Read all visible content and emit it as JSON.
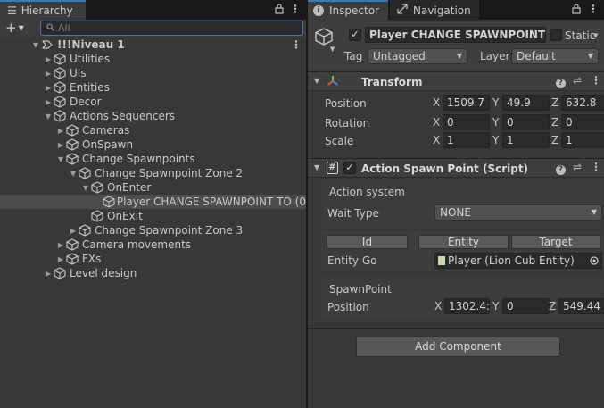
{
  "hierarchy": {
    "tab_label": "Hierarchy",
    "search_placeholder": "All",
    "tree": [
      {
        "label": "!!!Niveau 1",
        "indent": 0,
        "expanded": true,
        "scene": true
      },
      {
        "label": "Utilities",
        "indent": 1,
        "expanded": false
      },
      {
        "label": "UIs",
        "indent": 1,
        "expanded": false
      },
      {
        "label": "Entities",
        "indent": 1,
        "expanded": false
      },
      {
        "label": "Decor",
        "indent": 1,
        "expanded": false
      },
      {
        "label": "Actions Sequencers",
        "indent": 1,
        "expanded": true
      },
      {
        "label": "Cameras",
        "indent": 2,
        "expanded": false
      },
      {
        "label": "OnSpawn",
        "indent": 2,
        "expanded": false
      },
      {
        "label": "Change Spawnpoints",
        "indent": 2,
        "expanded": true
      },
      {
        "label": "Change Spawnpoint Zone 2",
        "indent": 3,
        "expanded": true
      },
      {
        "label": "OnEnter",
        "indent": 4,
        "expanded": true
      },
      {
        "label": "Player CHANGE SPAWNPOINT TO (0",
        "indent": 5,
        "leaf": true,
        "selected": true
      },
      {
        "label": "OnExit",
        "indent": 4,
        "leaf": true
      },
      {
        "label": "Change Spawnpoint Zone 3",
        "indent": 3,
        "expanded": false
      },
      {
        "label": "Camera movements",
        "indent": 2,
        "expanded": false
      },
      {
        "label": "FXs",
        "indent": 2,
        "expanded": false
      },
      {
        "label": "Level design",
        "indent": 1,
        "expanded": false
      }
    ]
  },
  "inspector": {
    "tabs": [
      {
        "label": "Inspector",
        "icon": "info-icon"
      },
      {
        "label": "Navigation",
        "icon": "navigation-icon"
      }
    ],
    "object": {
      "name": "Player CHANGE SPAWNPOINT TO",
      "static_label": "Static",
      "tag_label": "Tag",
      "tag_value": "Untagged",
      "layer_label": "Layer",
      "layer_value": "Default"
    },
    "transform": {
      "title": "Transform",
      "position_label": "Position",
      "rotation_label": "Rotation",
      "scale_label": "Scale",
      "position": {
        "x": "1509.7",
        "y": "49.9",
        "z": "632.8"
      },
      "rotation": {
        "x": "0",
        "y": "0",
        "z": "0"
      },
      "scale": {
        "x": "1",
        "y": "1",
        "z": "1"
      }
    },
    "action_spawn_point": {
      "title": "Action Spawn Point (Script)",
      "action_system_label": "Action system",
      "wait_type_label": "Wait Type",
      "wait_type_value": "NONE",
      "columns": [
        "Id",
        "Entity",
        "Target"
      ],
      "entity_go_label": "Entity Go",
      "entity_go_value": "Player (Lion Cub Entity)",
      "spawnpoint_label": "SpawnPoint",
      "position_label": "Position",
      "position": {
        "x": "1302.4:",
        "y": "0",
        "z": "549.44"
      }
    },
    "add_component_label": "Add Component"
  },
  "axes": {
    "x": "X",
    "y": "Y",
    "z": "Z"
  }
}
